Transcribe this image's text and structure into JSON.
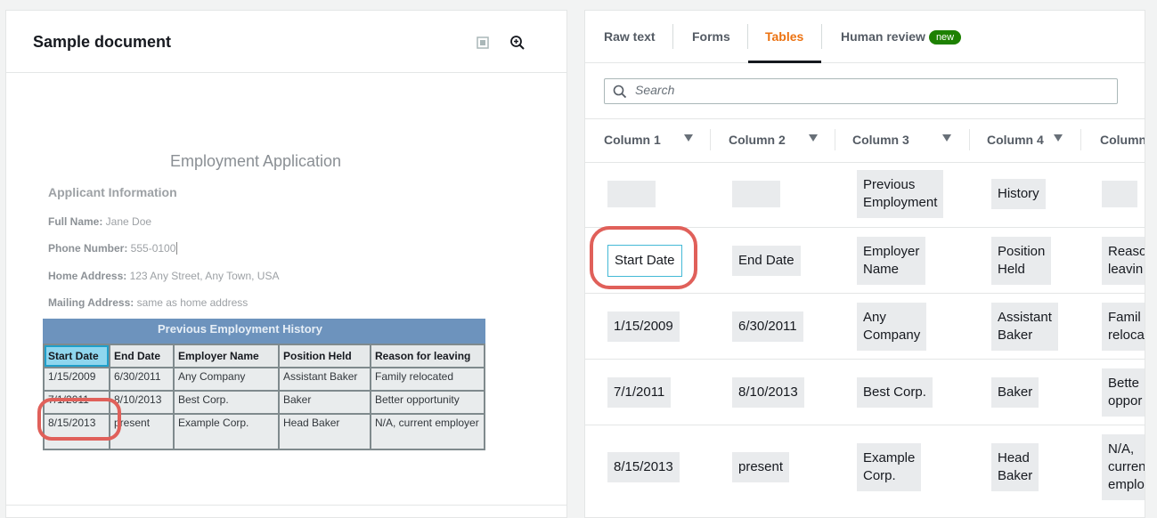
{
  "left": {
    "title": "Sample document",
    "doc_title": "Employment Application",
    "section": "Applicant Information",
    "fields": [
      {
        "label": "Full Name:",
        "value": " Jane Doe"
      },
      {
        "label": "Phone Number:",
        "value": " 555-0100"
      },
      {
        "label": "Home Address:",
        "value": " 123 Any Street, Any Town, USA"
      },
      {
        "label": "Mailing Address:",
        "value": " same as home address"
      }
    ],
    "table_title": "Previous Employment History",
    "table_headers": [
      "Start Date",
      "End Date",
      "Employer Name",
      "Position Held",
      "Reason for leaving"
    ],
    "table_rows": [
      [
        "1/15/2009",
        "6/30/2011",
        "Any Company",
        "Assistant Baker",
        "Family relocated"
      ],
      [
        "7/1/2011",
        "8/10/2013",
        "Best Corp.",
        "Baker",
        "Better opportunity"
      ],
      [
        "8/15/2013",
        "present",
        "Example Corp.",
        "Head Baker",
        "N/A, current employer"
      ]
    ]
  },
  "tabs": [
    {
      "label": "Raw text"
    },
    {
      "label": "Forms"
    },
    {
      "label": "Tables"
    },
    {
      "label": "Human review",
      "badge": "new"
    }
  ],
  "search": {
    "placeholder": "Search"
  },
  "columns": [
    "Column 1",
    "Column 2",
    "Column 3",
    "Column 4",
    "Column"
  ],
  "rows": [
    [
      "",
      "",
      "Previous Employment",
      "History",
      ""
    ],
    [
      "Start Date",
      "End Date",
      "Employer Name",
      "Position Held",
      "Reason leaving"
    ],
    [
      "1/15/2009",
      "6/30/2011",
      "Any Company",
      "Assistant Baker",
      "Family relocated"
    ],
    [
      "7/1/2011",
      "8/10/2013",
      "Best Corp.",
      "Baker",
      "Better opportunity"
    ],
    [
      "8/15/2013",
      "present",
      "Example Corp.",
      "Head Baker",
      "N/A, current employer"
    ]
  ],
  "rows_display": [
    [
      "",
      "",
      "Previous\nEmployment",
      "History",
      ""
    ],
    [
      "Start Date",
      "End Date",
      "Employer\nName",
      "Position\nHeld",
      "Reaso\nleavin"
    ],
    [
      "1/15/2009",
      "6/30/2011",
      "Any\nCompany",
      "Assistant\nBaker",
      "Famil\nrelocat"
    ],
    [
      "7/1/2011",
      "8/10/2013",
      "Best Corp.",
      "Baker",
      "Bette\noppor"
    ],
    [
      "8/15/2013",
      "present",
      "Example\nCorp.",
      "Head\nBaker",
      "N/A,\ncurren\nemplo"
    ]
  ],
  "colors": {
    "accent_tab": "#ec7211",
    "badge": "#1d8102",
    "highlight": "#e0605a",
    "selection": "#44b9d6",
    "table_header": "#6d93bd"
  }
}
